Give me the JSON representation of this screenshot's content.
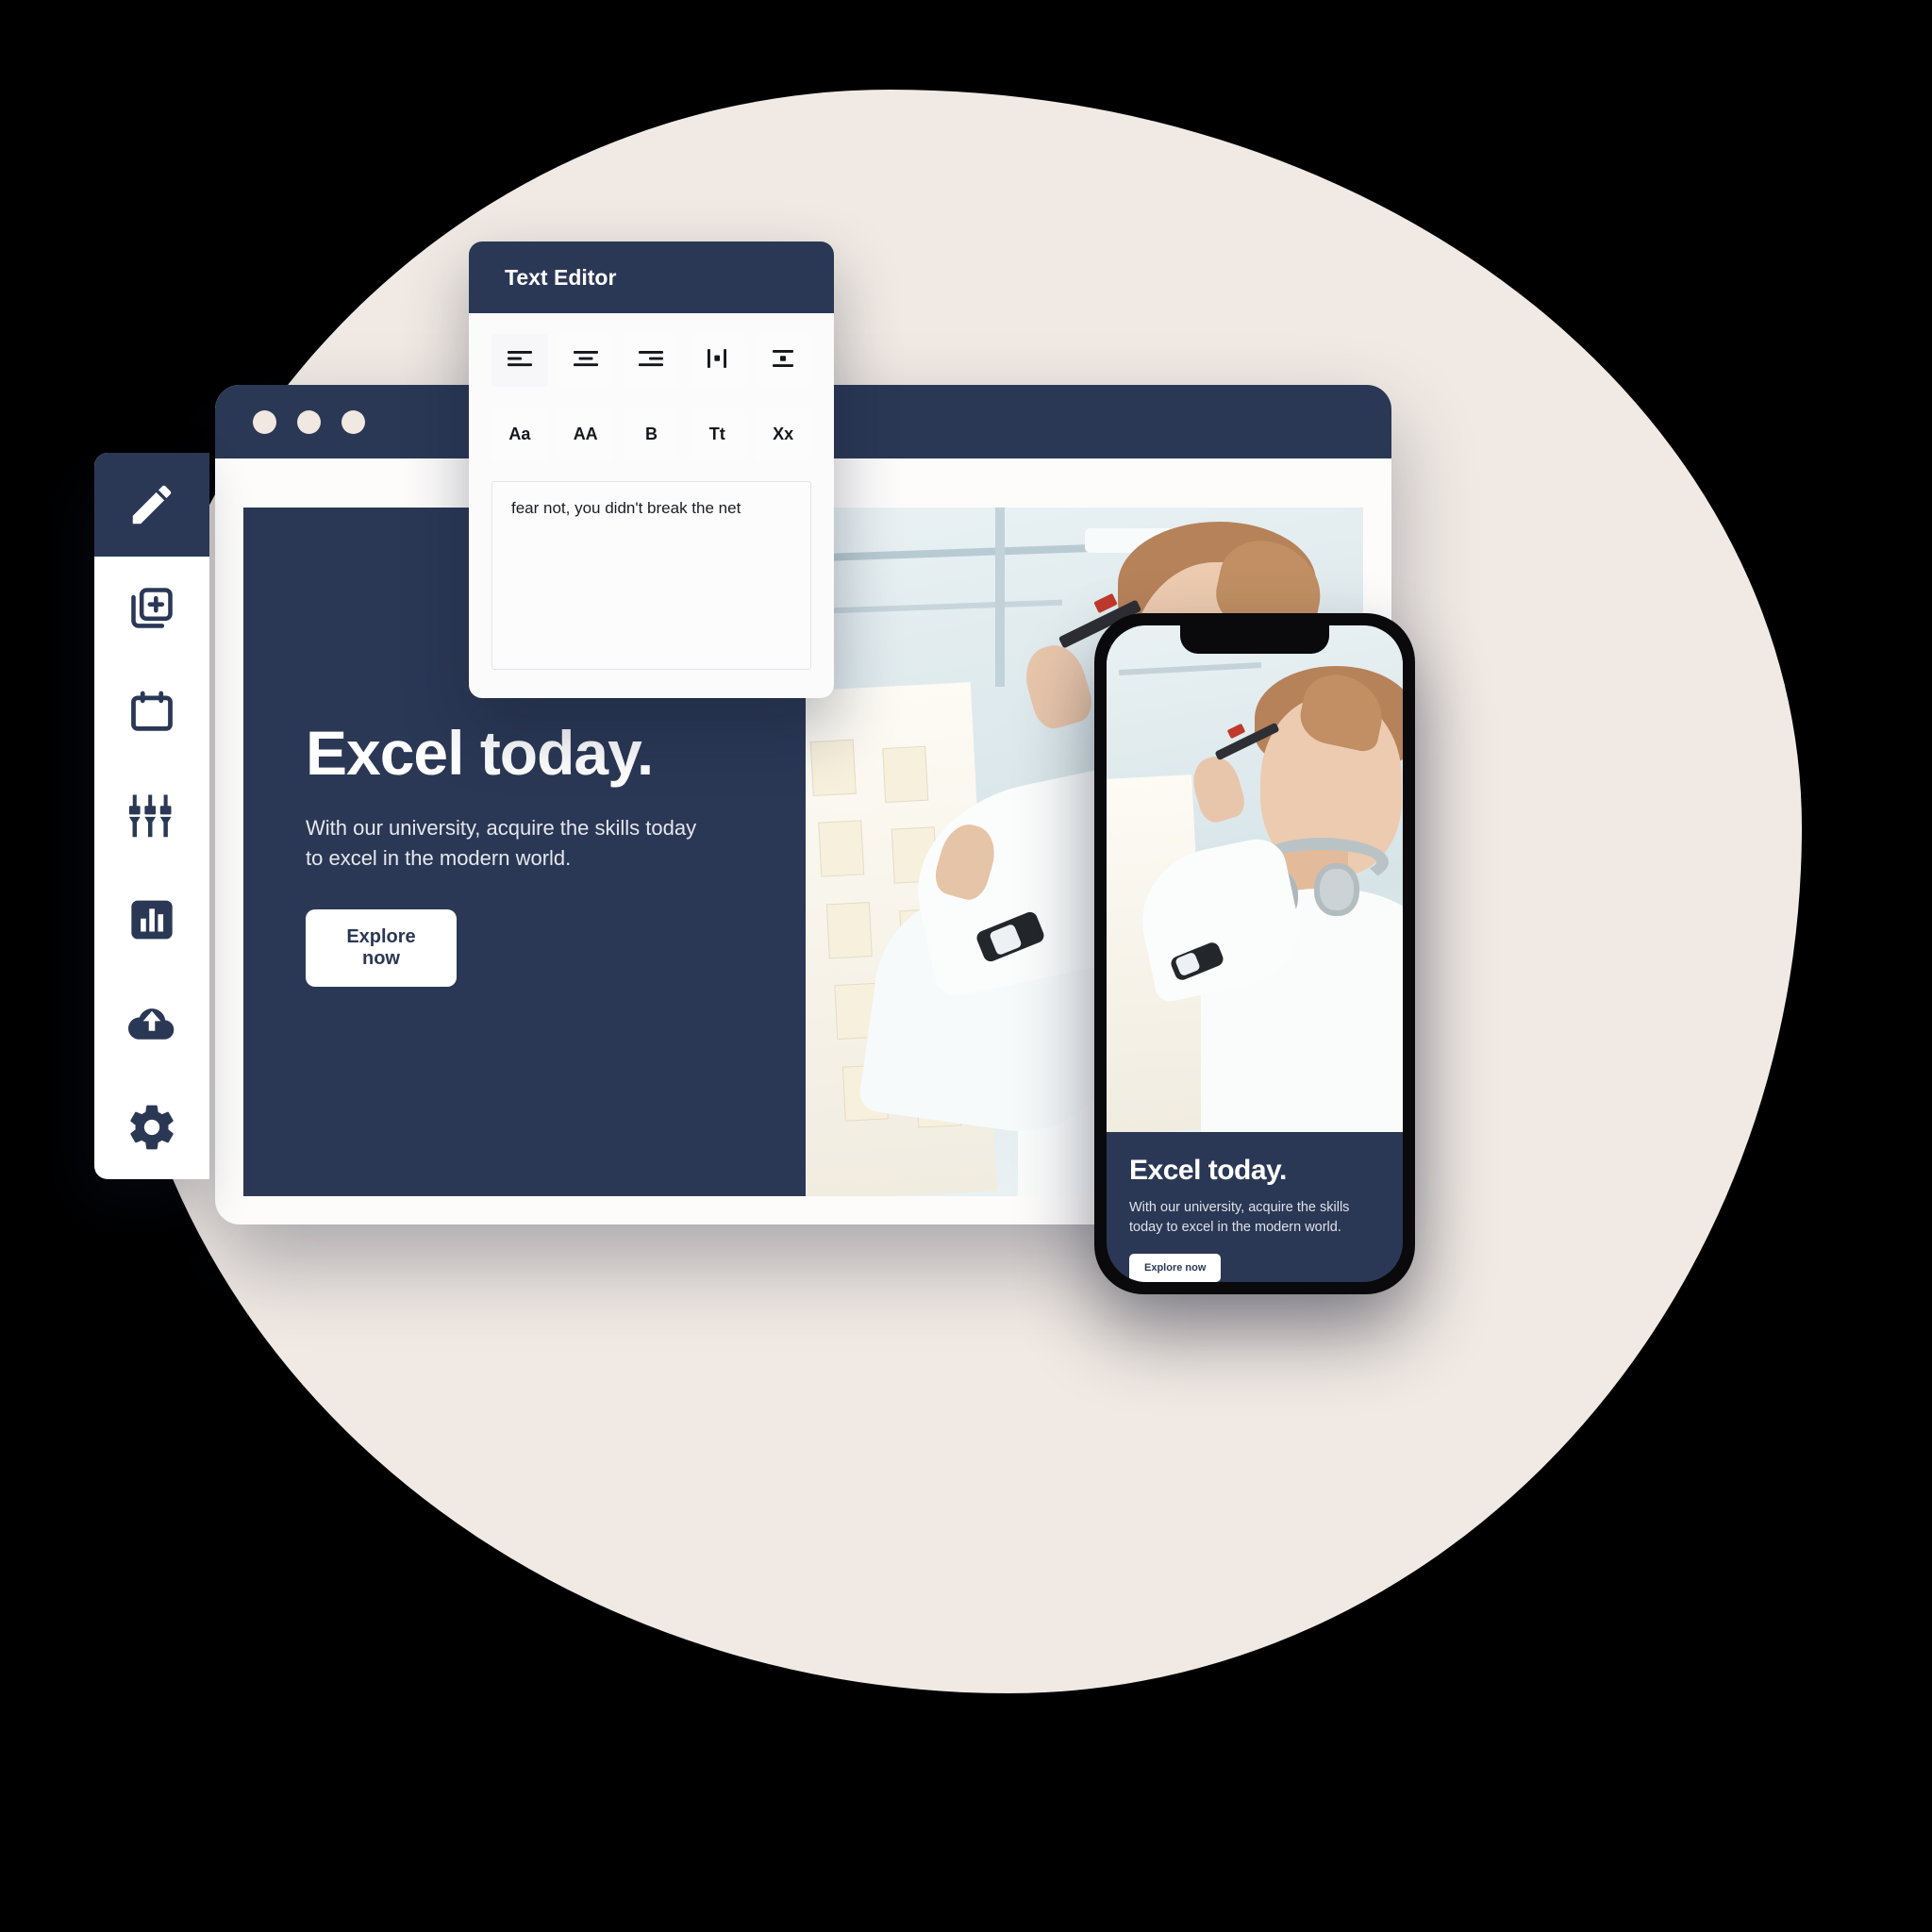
{
  "theme": {
    "navy": "#2b3855",
    "blob_beige": "#f1eae4",
    "white": "#ffffff",
    "panel_gray": "#f7f7f9"
  },
  "browser": {
    "window_dots": [
      "dot-1",
      "dot-2",
      "dot-3"
    ],
    "hero": {
      "title": "Excel today.",
      "subtitle": "With our university, acquire the skills today to excel in the modern world.",
      "button_label": "Explore now"
    }
  },
  "phone": {
    "hero": {
      "title": "Excel today.",
      "subtitle": "With our university, acquire the skills today to excel in the modern world.",
      "button_label": "Explore now"
    }
  },
  "rail": {
    "items": [
      {
        "icon": "pencil-icon",
        "active": true
      },
      {
        "icon": "add-layer-icon",
        "active": false
      },
      {
        "icon": "calendar-icon",
        "active": false
      },
      {
        "icon": "sliders-icon",
        "active": false
      },
      {
        "icon": "bar-chart-icon",
        "active": false
      },
      {
        "icon": "cloud-upload-icon",
        "active": false
      },
      {
        "icon": "gear-icon",
        "active": false
      }
    ]
  },
  "editor": {
    "title": "Text Editor",
    "toolbar_row1": [
      {
        "label": "",
        "icon": "align-left-icon"
      },
      {
        "label": "",
        "icon": "align-center-icon"
      },
      {
        "label": "",
        "icon": "align-right-icon"
      },
      {
        "label": "",
        "icon": "align-horizontal-center-icon"
      },
      {
        "label": "",
        "icon": "align-vertical-center-icon"
      }
    ],
    "toolbar_row2": [
      {
        "label": "Aa",
        "icon": "font-case-icon"
      },
      {
        "label": "AA",
        "icon": "uppercase-icon"
      },
      {
        "label": "B",
        "icon": "bold-icon"
      },
      {
        "label": "Tt",
        "icon": "text-size-icon"
      },
      {
        "label": "Xx",
        "icon": "clear-format-icon"
      }
    ],
    "content": "fear not, you didn't break the net"
  }
}
